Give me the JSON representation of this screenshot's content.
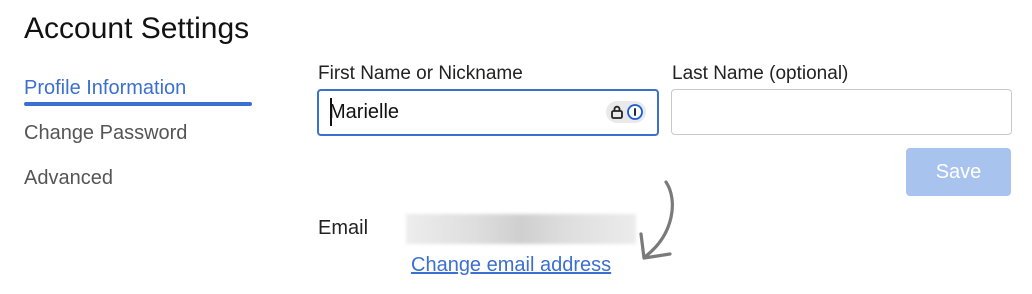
{
  "page": {
    "title": "Account Settings"
  },
  "sidebar": {
    "items": [
      {
        "label": "Profile Information",
        "active": true
      },
      {
        "label": "Change Password",
        "active": false
      },
      {
        "label": "Advanced",
        "active": false
      }
    ]
  },
  "form": {
    "first_name": {
      "label": "First Name or Nickname",
      "value": "Marielle"
    },
    "last_name": {
      "label": "Last Name (optional)",
      "value": ""
    },
    "save_label": "Save",
    "email_label": "Email",
    "change_email_label": "Change email address"
  },
  "icons": {
    "password_manager": [
      "lock-icon",
      "password-manager-icon"
    ],
    "annotation": "curved-arrow-icon"
  },
  "colors": {
    "accent": "#3b6fd0",
    "save_disabled": "#a9c3ef"
  }
}
